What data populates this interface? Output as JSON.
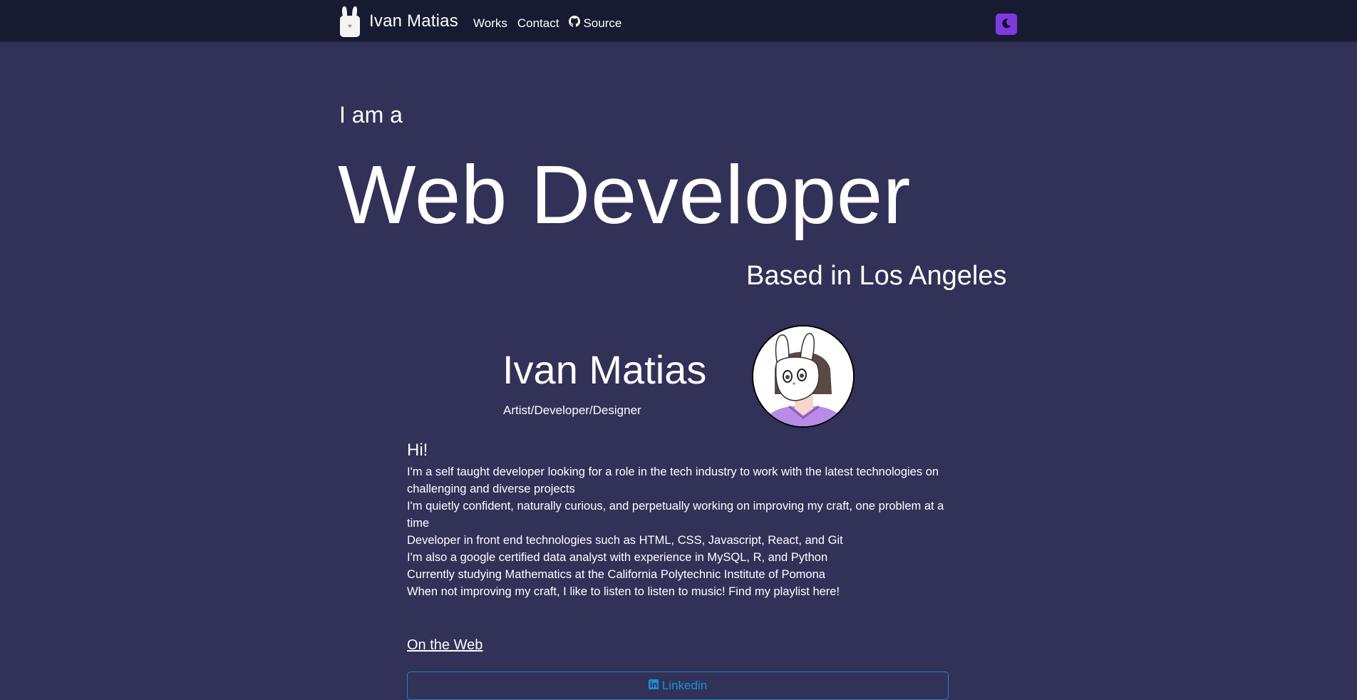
{
  "nav": {
    "brand": "Ivan Matias",
    "links": [
      {
        "label": "Works"
      },
      {
        "label": "Contact"
      },
      {
        "label": "Source",
        "icon": "github-icon"
      }
    ],
    "theme_icon": "moon-icon"
  },
  "hero": {
    "intro": "I am a",
    "title": "Web Developer",
    "location": "Based in Los Angeles"
  },
  "profile": {
    "name": "Ivan Matias",
    "role": "Artist/Developer/Designer"
  },
  "about": {
    "heading": "Hi!",
    "lines": [
      "I'm a self taught developer looking for a role in the tech industry to work with the latest technologies on challenging and diverse projects",
      "I'm quietly confident, naturally curious, and perpetually working on improving my craft, one problem at a time",
      "Developer in front end technologies such as HTML, CSS, Javascript, React, and Git",
      "I'm also a google certified data analyst with experience in MySQL, R, and Python",
      "Currently studying Mathematics at the California Polytechnic Institute of Pomona",
      "When not improving my craft, I like to listen to listen to music! Find my playlist here!"
    ]
  },
  "web": {
    "heading": "On the Web",
    "linkedin_label": "Linkedin"
  },
  "colors": {
    "background": "#323158",
    "navbar": "#171b31",
    "toggle": "#7e3ae2",
    "linkedin": "#1b8fd4"
  }
}
